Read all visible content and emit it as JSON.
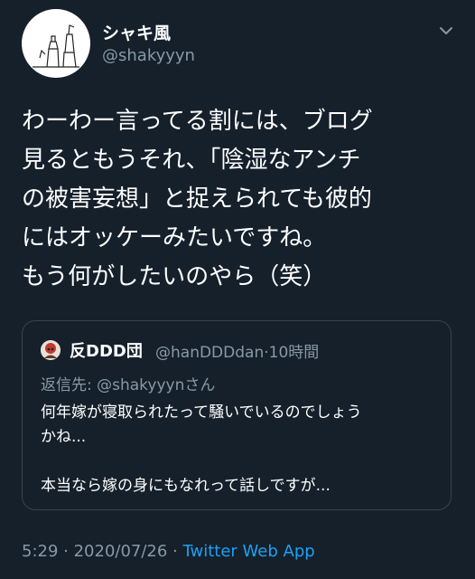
{
  "author": {
    "display_name": "シャキ風",
    "handle": "@shakyyyn",
    "avatar_icon": "sketch-avatar-icon"
  },
  "tweet": {
    "text": "わーわー言ってる割には、ブログ\n見るともうそれ、「陰湿なアンチ\nの被害妄想」と捉えられても彼的\nにはオッケーみたいですね。\nもう何がしたいのやら（笑）"
  },
  "quote": {
    "display_name": "反DDD団",
    "handle_time": "@hanDDDdan·10時間",
    "reply_to": "返信先: @shakyyynさん",
    "text": "何年嫁が寝取られたって騒いでいるのでしょう\nかね...\n\n本当なら嫁の身にもなれって話しですが..."
  },
  "footer": {
    "time_date": "5:29 · 2020/07/26 · ",
    "source": "Twitter Web App"
  },
  "colors": {
    "background": "#15202b",
    "secondary_text": "#8899a6",
    "link": "#1da1f2",
    "border": "#38444d"
  }
}
